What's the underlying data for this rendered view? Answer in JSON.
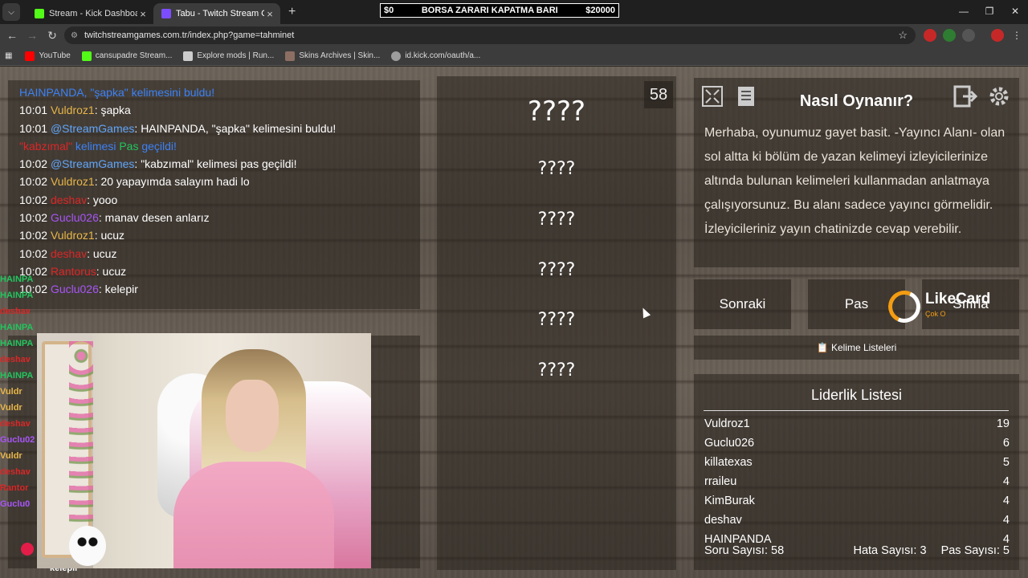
{
  "browser": {
    "tabs": [
      {
        "title": "Stream - Kick Dashboard",
        "active": false,
        "favicon_color": "#53fc18"
      },
      {
        "title": "Tabu - Twitch Stream Games",
        "active": true,
        "favicon_color": "#7c4dff"
      }
    ],
    "borsa_bar": {
      "left": "$0",
      "title": "BORSA ZARARI KAPATMA BARI",
      "right": "$20000"
    },
    "url": "twitchstreamgames.com.tr/index.php?game=tahminet",
    "bookmarks": [
      {
        "label": "YouTube",
        "icon_color": "#ff0000"
      },
      {
        "label": "cansupadre Stream...",
        "icon_color": "#53fc18"
      },
      {
        "label": "Explore mods | Run...",
        "icon_color": "#cccccc"
      },
      {
        "label": "Skins Archives | Skin...",
        "icon_color": "#8d6e63"
      },
      {
        "label": "id.kick.com/oauth/a...",
        "icon_color": "#9e9e9e"
      }
    ]
  },
  "chat": {
    "lines": [
      {
        "time": "",
        "user": "",
        "user_class": "",
        "sep": "",
        "msg": "",
        "notice": "HAINPANDA, \"şapka\" kelimesini buldu!"
      },
      {
        "time": "10:01",
        "user": "Vuldroz1",
        "user_class": "c-gold",
        "sep": ": ",
        "msg": "şapka"
      },
      {
        "time": "10:01",
        "user": "@StreamGames",
        "user_class": "c-sbl",
        "sep": ": ",
        "msg": "HAINPANDA, \"şapka\" kelimesini buldu!"
      },
      {
        "time": "",
        "user": "\"kabzımal\"",
        "user_class": "c-red",
        "sep": "",
        "msg": "",
        "notice2": " kelimesi ",
        "notice3": "Pas",
        "notice4": " geçildi!"
      },
      {
        "time": "10:02",
        "user": "@StreamGames",
        "user_class": "c-sbl",
        "sep": ": ",
        "msg": "\"kabzımal\" kelimesi pas geçildi!"
      },
      {
        "time": "10:02",
        "user": "Vuldroz1",
        "user_class": "c-gold",
        "sep": ": ",
        "msg": "20 yapayımda salayım hadi lo"
      },
      {
        "time": "10:02",
        "user": "deshav",
        "user_class": "c-red",
        "sep": ": ",
        "msg": "yooo"
      },
      {
        "time": "10:02",
        "user": "Guclu026",
        "user_class": "c-purple",
        "sep": ": ",
        "msg": "manav desen anlarız"
      },
      {
        "time": "10:02",
        "user": "Vuldroz1",
        "user_class": "c-gold",
        "sep": ": ",
        "msg": "ucuz"
      },
      {
        "time": "10:02",
        "user": "deshav",
        "user_class": "c-red",
        "sep": ": ",
        "msg": "ucuz"
      },
      {
        "time": "10:02",
        "user": "Rantorus",
        "user_class": "c-red",
        "sep": ": ",
        "msg": "ucuz"
      },
      {
        "time": "10:02",
        "user": "Guclu026",
        "user_class": "c-purple",
        "sep": ": ",
        "msg": "kelepir"
      }
    ]
  },
  "side_chat": [
    {
      "name": "HAINPA",
      "color": "#22c55e"
    },
    {
      "name": "HAINPA",
      "color": "#22c55e"
    },
    {
      "name": "deshav",
      "color": "#dc2626"
    },
    {
      "name": "HAINPA",
      "color": "#22c55e"
    },
    {
      "name": "HAINPA",
      "color": "#22c55e"
    },
    {
      "name": "deshav",
      "color": "#dc2626"
    },
    {
      "name": "HAINPA",
      "color": "#22c55e"
    },
    {
      "name": "Vuldr",
      "color": "#e8b649"
    },
    {
      "name": "Vuldr",
      "color": "#e8b649"
    },
    {
      "name": "deshav",
      "color": "#dc2626"
    },
    {
      "name": "Guclu02",
      "color": "#a855f7"
    },
    {
      "name": "Vuldr",
      "color": "#e8b649"
    },
    {
      "name": "deshav",
      "color": "#dc2626"
    },
    {
      "name": "Rantor",
      "color": "#dc2626"
    },
    {
      "name": "Guclu0",
      "color": "#a855f7"
    }
  ],
  "side_chat_last_msg": "kelepir",
  "game": {
    "counter": "58",
    "main_word": "????",
    "taboo_words": [
      "????",
      "????",
      "????",
      "????",
      "????"
    ]
  },
  "howto": {
    "title": "Nasıl Oynanır?",
    "text": "Merhaba, oyunumuz gayet basit. -Yayıncı Alanı- olan sol altta ki bölüm de yazan kelimeyi izleyicilerinize altında bulunan kelimeleri kullanmadan anlatmaya çalışıyorsunuz. Bu alanı sadece yayıncı görmelidir. İzleyicileriniz yayın chatinizde cevap verebilir."
  },
  "actions": {
    "next": "Sonraki",
    "pass": "Pas",
    "reset": "Sıfırla",
    "word_lists": "Kelime Listeleri",
    "word_lists_icon": "📋"
  },
  "likecard": {
    "name": "LikeCard",
    "sub": "Çok O"
  },
  "leaderboard": {
    "title": "Liderlik Listesi",
    "rows": [
      {
        "name": "Vuldroz1",
        "score": "19"
      },
      {
        "name": "Guclu026",
        "score": "6"
      },
      {
        "name": "killatexas",
        "score": "5"
      },
      {
        "name": "rraileu",
        "score": "4"
      },
      {
        "name": "KimBurak",
        "score": "4"
      },
      {
        "name": "deshav",
        "score": "4"
      },
      {
        "name": "HAINPANDA",
        "score": "4"
      }
    ],
    "footer": {
      "questions": "Soru Sayısı: 58",
      "errors": "Hata Sayısı: 3",
      "passes": "Pas Sayısı: 5"
    }
  }
}
